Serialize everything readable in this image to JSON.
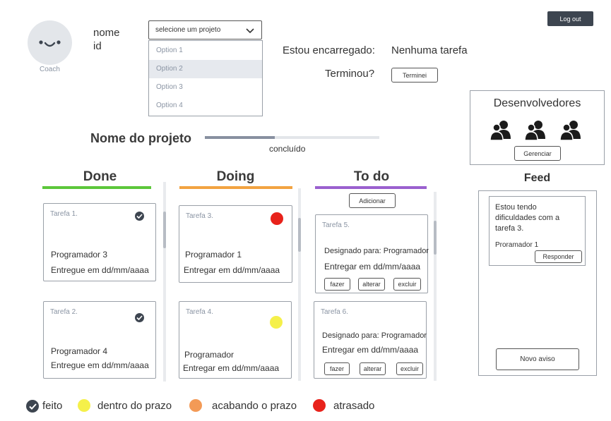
{
  "header": {
    "avatar_label": "Coach",
    "name": "nome",
    "id": "id",
    "logout": "Log out",
    "project_select": {
      "placeholder": "selecione um projeto",
      "options": [
        "Option 1",
        "Option 2",
        "Option 3",
        "Option 4"
      ],
      "highlighted_index": 1
    },
    "in_charge_label": "Estou encarregado:",
    "in_charge_value": "Nenhuma tarefa",
    "finished_label": "Terminou?",
    "finished_button": "Terminei"
  },
  "project": {
    "title": "Nome do projeto",
    "progress_label": "concluído",
    "progress_fraction": 0.4
  },
  "developers": {
    "title": "Desenvolvedores",
    "manage_button": "Gerenciar"
  },
  "feed": {
    "title": "Feed",
    "post": {
      "text": "Estou tendo dificuldades com a tarefa 3.",
      "author": "Proramador 1",
      "reply_button": "Responder"
    },
    "new_button": "Novo aviso"
  },
  "columns": {
    "done": {
      "title": "Done",
      "color": "#5cc73a",
      "cards": [
        {
          "name": "Tarefa 1.",
          "line1": "Programador 3",
          "line2": "Entregue em dd/mm/aaaa"
        },
        {
          "name": "Tarefa 2.",
          "line1": "Programador 4",
          "line2": "Entregue em dd/mm/aaaa"
        }
      ]
    },
    "doing": {
      "title": "Doing",
      "color": "#f2a341",
      "cards": [
        {
          "name": "Tarefa 3.",
          "line1": "Programador 1",
          "line2": "Entregar em dd/mm/aaaa",
          "status_color": "#e8221b"
        },
        {
          "name": "Tarefa 4.",
          "line1": "Programador",
          "line2": "Entregar em dd/mm/aaaa",
          "status_color": "#f5f04a"
        }
      ]
    },
    "todo": {
      "title": "To do",
      "color": "#9a60cf",
      "add_button": "Adicionar",
      "cards": [
        {
          "name": "Tarefa 5.",
          "line1": "Designado para: Programador",
          "line2": "Entregar em dd/mm/aaaa",
          "actions": [
            "fazer",
            "alterar",
            "excluir"
          ]
        },
        {
          "name": "Tarefa 6.",
          "line1": "Designado para: Programador",
          "line2": "Entregar em dd/mm/aaaa",
          "actions": [
            "fazer",
            "alterar",
            "excluir"
          ]
        }
      ]
    }
  },
  "legend": [
    {
      "label": "feito",
      "icon": "check-circle-icon",
      "color": "#3d4550"
    },
    {
      "label": "dentro do prazo",
      "icon": "dot",
      "color": "#f5f04a"
    },
    {
      "label": "acabando o prazo",
      "icon": "dot",
      "color": "#f39a56"
    },
    {
      "label": "atrasado",
      "icon": "dot",
      "color": "#e8221b"
    }
  ]
}
